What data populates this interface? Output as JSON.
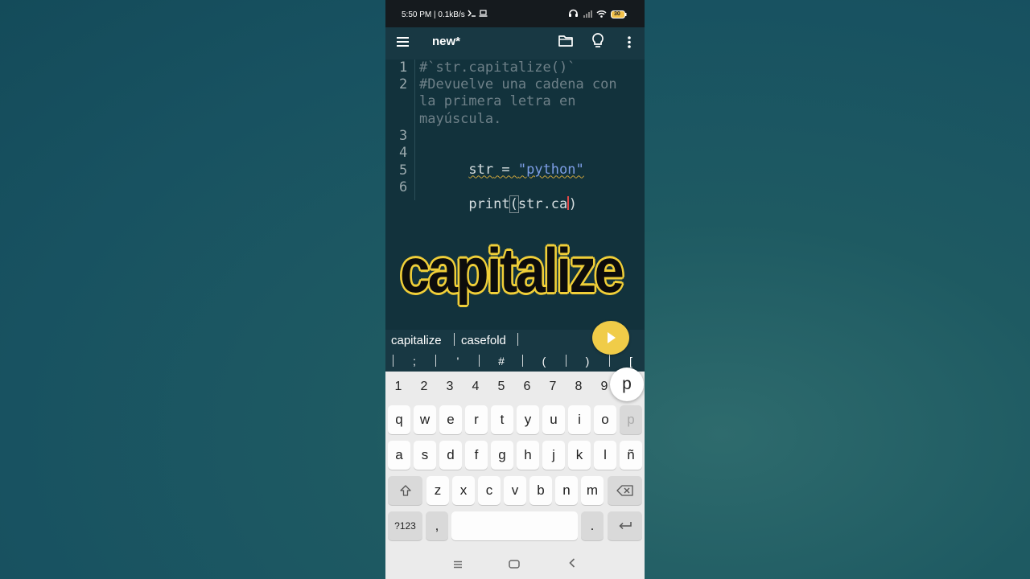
{
  "status_bar": {
    "time_speed": "5:50 PM | 0.1kB/s",
    "battery": "30"
  },
  "app_bar": {
    "title": "new*"
  },
  "editor": {
    "line_numbers": [
      "1",
      "2",
      "3",
      "4",
      "5",
      "6"
    ],
    "lines": {
      "l1": "#`str.capitalize()`",
      "l2a": "#Devuelve una cadena con",
      "l2b": "la primera letra en",
      "l2c": "mayúscula.",
      "l4_var": "str",
      "l4_eq": " = ",
      "l4_str": "\"python\"",
      "l6_print": "print",
      "l6_open": "(",
      "l6_arg": "str.ca",
      "l6_close": ")"
    }
  },
  "overlay": {
    "word": "capitalize"
  },
  "suggestions": [
    "capitalize",
    "casefold"
  ],
  "symbols": [
    ";",
    "'",
    "#",
    "(",
    ")",
    "["
  ],
  "keyboard": {
    "numbers": [
      "1",
      "2",
      "3",
      "4",
      "5",
      "6",
      "7",
      "8",
      "9"
    ],
    "row1": [
      "q",
      "w",
      "e",
      "r",
      "t",
      "y",
      "u",
      "i",
      "o",
      "p"
    ],
    "row2": [
      "a",
      "s",
      "d",
      "f",
      "g",
      "h",
      "j",
      "k",
      "l",
      "ñ"
    ],
    "row3": [
      "z",
      "x",
      "c",
      "v",
      "b",
      "n",
      "m"
    ],
    "symbols_key": "?123",
    "comma_key": ",",
    "period_key": ".",
    "popup_key": "p"
  },
  "icons": {
    "menu": "hamburger-icon",
    "folder": "folder-icon",
    "bulb": "lightbulb-icon",
    "more": "more-vertical-icon",
    "run": "play-icon",
    "shift": "shift-icon",
    "backspace": "backspace-icon",
    "enter": "enter-icon"
  },
  "colors": {
    "accent": "#f0cc48",
    "editor_bg": "#12323c",
    "string": "#7d9ee6"
  }
}
